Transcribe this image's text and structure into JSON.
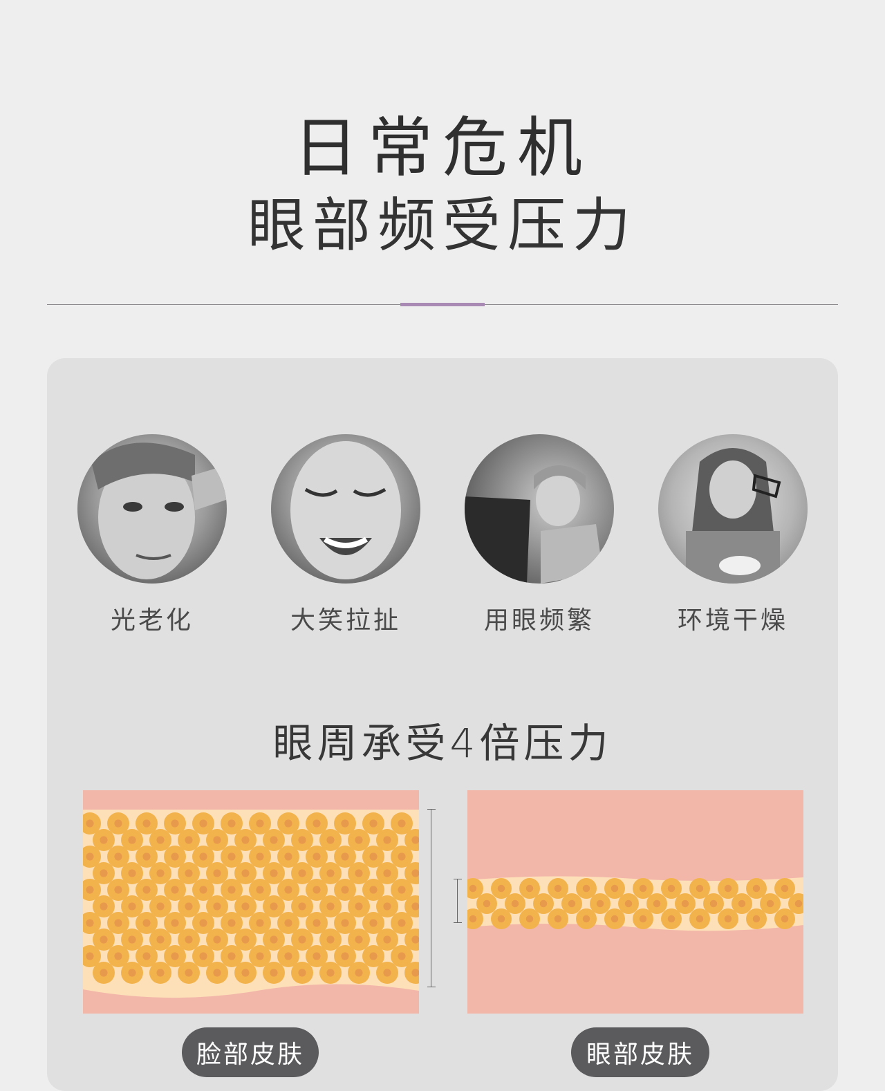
{
  "header": {
    "title_line1": "日常危机",
    "title_line2": "眼部频受压力"
  },
  "causes": [
    {
      "label": "光老化",
      "icon": "woman-touching-forehead-photo"
    },
    {
      "label": "大笑拉扯",
      "icon": "laughing-woman-photo"
    },
    {
      "label": "用眼频繁",
      "icon": "child-with-tablet-photo"
    },
    {
      "label": "环境干燥",
      "icon": "tired-woman-rubbing-eye-photo"
    }
  ],
  "comparison": {
    "title": "眼周承受4倍压力",
    "face_skin_label": "脸部皮肤",
    "eye_skin_label": "眼部皮肤"
  },
  "colors": {
    "accent": "#a98ab4",
    "card_bg": "#e1e0e1",
    "skin_outer": "#f3b7aa",
    "fat_layer": "#fde0b8",
    "fat_cell": "#f3b34c",
    "pill_bg": "#5b5a5c"
  }
}
